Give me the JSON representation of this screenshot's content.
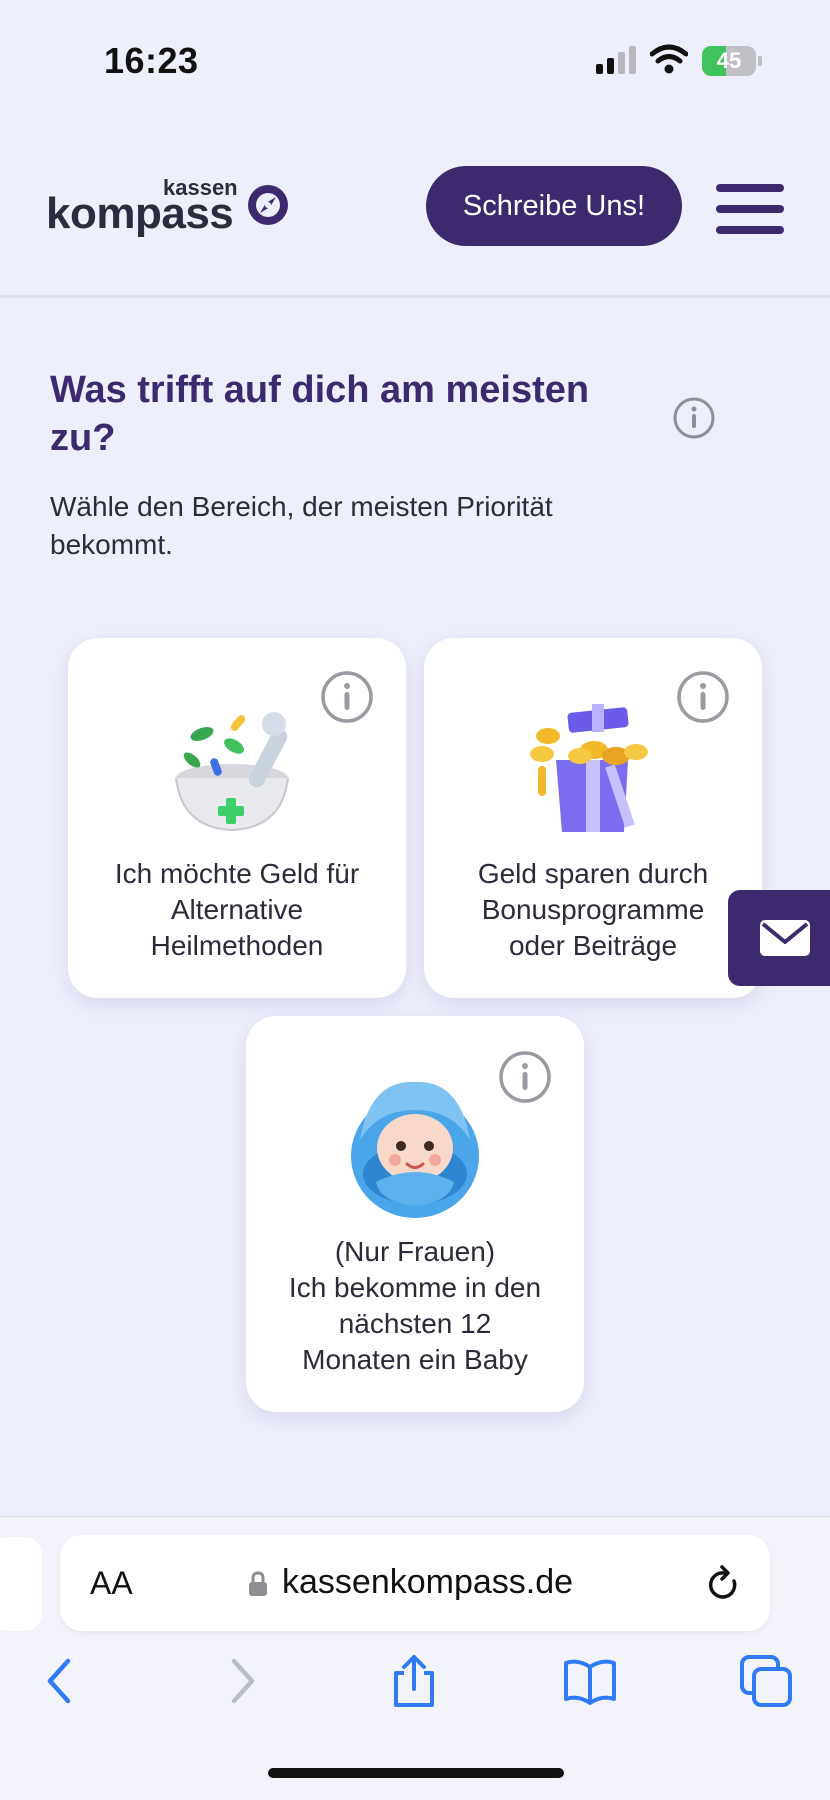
{
  "status_bar": {
    "time": "16:23",
    "battery_level": "45",
    "battery_fraction": 0.45
  },
  "header": {
    "logo_small": "kassen",
    "logo_big": "kompass",
    "cta_label": "Schreibe Uns!",
    "menu_icon": "hamburger-menu-icon"
  },
  "question": {
    "title": "Was trifft auf dich am meisten zu?",
    "subtitle": "Wähle den Bereich, der meisten Priorität bekommt."
  },
  "cards": [
    {
      "label": "Ich möchte Geld für\nAlternative\nHeilmethoden",
      "icon": "mortar-pestle-icon"
    },
    {
      "label": "Geld sparen durch\nBonusprogramme\noder Beiträge",
      "icon": "gift-box-coins-icon"
    },
    {
      "label": "(Nur Frauen)\nIch bekomme in den\nnächsten 12\nMonaten ein Baby",
      "icon": "baby-icon"
    }
  ],
  "colors": {
    "brand": "#3d2a6e",
    "background": "#eeeffc",
    "battery_green": "#3fc35a"
  },
  "browser": {
    "text_size_label": "AA",
    "url": "kassenkompass.de"
  }
}
